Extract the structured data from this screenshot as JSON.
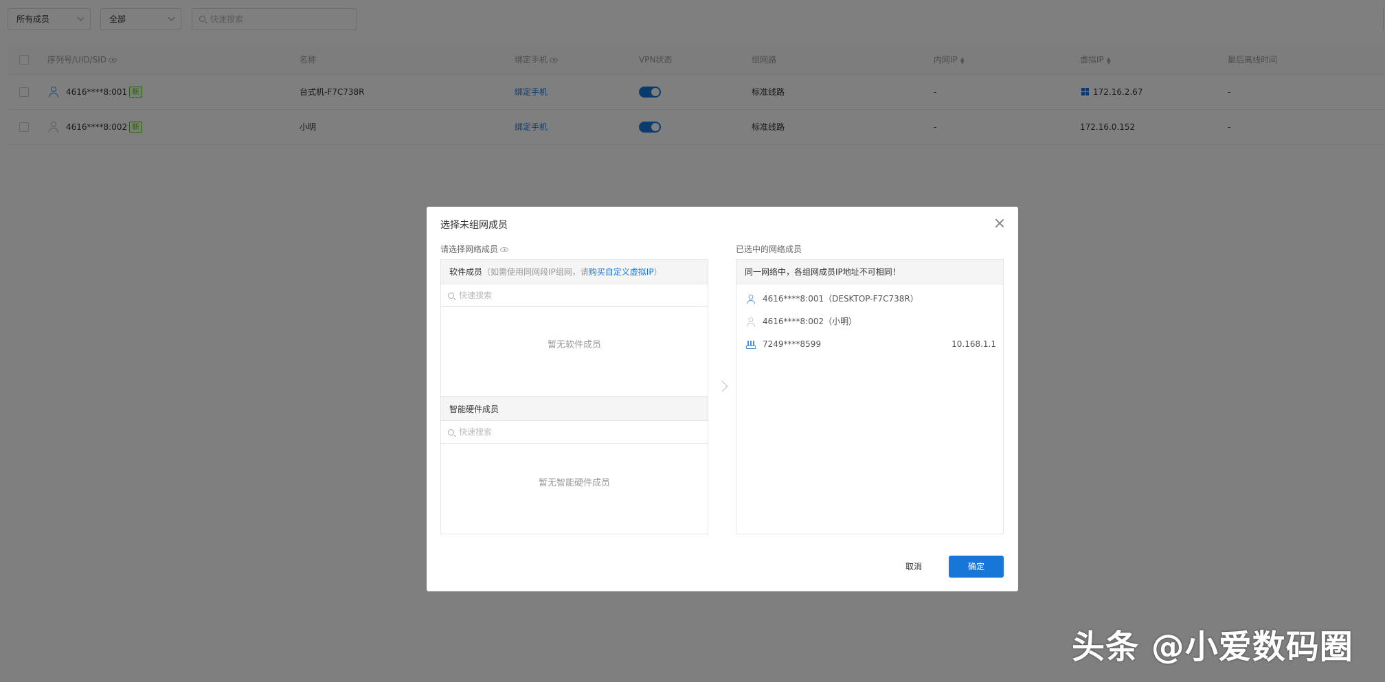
{
  "filters": {
    "member_select": "所有成员",
    "status_select": "全部",
    "search_placeholder": "快速搜索"
  },
  "table": {
    "headers": {
      "sid": "序列号/UID/SID",
      "name": "名称",
      "phone": "绑定手机",
      "vpn": "VPN状态",
      "route": "组网路",
      "lan_ip": "内网IP",
      "virtual_ip": "虚拟IP",
      "last_offline": "最后离线时间"
    },
    "rows": [
      {
        "sid": "4616****8:001",
        "tag": "新",
        "name": "台式机-F7C738R",
        "phone": "绑定手机",
        "vpn_on": true,
        "route": "标准线路",
        "lan_ip": "-",
        "virtual_ip": "172.16.2.67",
        "os": "windows-icon",
        "last_offline": "-"
      },
      {
        "sid": "4616****8:002",
        "tag": "新",
        "name": "小明",
        "phone": "绑定手机",
        "vpn_on": true,
        "route": "标准线路",
        "lan_ip": "-",
        "virtual_ip": "172.16.0.152",
        "last_offline": "-"
      }
    ]
  },
  "modal": {
    "title": "选择未组网成员",
    "left_label": "请选择网络成员",
    "software_head": "软件成员",
    "software_hint_prefix": "（如需使用同网段IP组网，请",
    "software_hint_link": "购买自定义虚拟IP",
    "software_hint_suffix": "）",
    "software_search_placeholder": "快速搜索",
    "software_empty": "暂无软件成员",
    "hardware_head": "智能硬件成员",
    "hardware_search_placeholder": "快速搜索",
    "hardware_empty": "暂无智能硬件成员",
    "right_label": "已选中的网络成员",
    "right_notice": "同一网络中，各组网成员IP地址不可相同！",
    "selected": [
      {
        "text": "4616****8:001（DESKTOP-F7C738R）",
        "icon": "user-icon",
        "ip": ""
      },
      {
        "text": "4616****8:002（小明）",
        "icon": "user-icon",
        "ip": ""
      },
      {
        "text": "7249****8599",
        "icon": "router-icon",
        "ip": "10.168.1.1"
      }
    ],
    "cancel": "取消",
    "confirm": "确定"
  },
  "watermark": "头条 @小爱数码圈",
  "colors": {
    "accent": "#1677d9",
    "new_tag": "#52c41a",
    "overlay": "rgba(0,0,0,0.5)"
  }
}
